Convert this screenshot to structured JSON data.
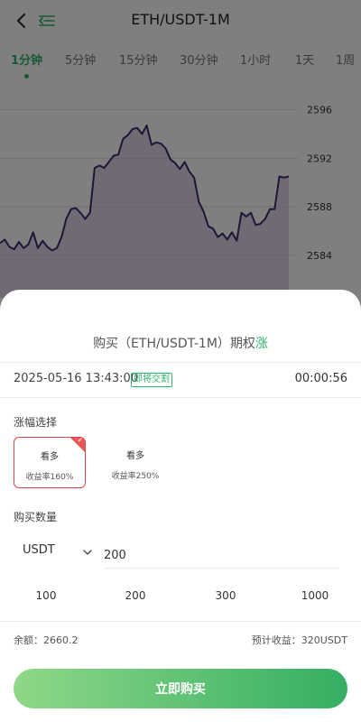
{
  "header": {
    "title": "ETH/USDT-1M"
  },
  "timeframes": [
    "1分钟",
    "5分钟",
    "15分钟",
    "30分钟",
    "1小时",
    "1天",
    "1周"
  ],
  "chart_data": {
    "type": "line",
    "y_ticks": [
      "2596",
      "2592",
      "2588",
      "2584"
    ],
    "ylim": [
      2580.5,
      2597.6
    ],
    "series": [
      {
        "values": [
          2585.0,
          2585.3,
          2584.7,
          2584.5,
          2585.1,
          2584.6,
          2584.9,
          2585.9,
          2584.6,
          2585.2,
          2584.7,
          2584.4,
          2584.6,
          2585.5,
          2587.0,
          2587.8,
          2587.9,
          2587.5,
          2587.0,
          2587.5,
          2591.2,
          2591.4,
          2591.2,
          2591.7,
          2592.2,
          2592.3,
          2593.6,
          2593.9,
          2594.4,
          2594.5,
          2594.0,
          2594.7,
          2593.1,
          2593.3,
          2593.2,
          2592.8,
          2591.9,
          2591.6,
          2591.1,
          2591.7,
          2590.9,
          2590.4,
          2588.4,
          2587.6,
          2586.4,
          2586.2,
          2585.5,
          2585.8,
          2585.3,
          2585.9,
          2585.2,
          2587.5,
          2587.2,
          2587.5,
          2586.5,
          2586.6,
          2587.0,
          2587.8,
          2587.8,
          2590.5,
          2590.4,
          2590.5
        ]
      }
    ]
  },
  "order": {
    "title_prefix": "购买（ETH/USDT-1M）期权",
    "direction": "涨",
    "datetime": "2025-05-16 13:43:00",
    "badge": "即将交割",
    "countdown": "00:00:56",
    "range_label": "涨幅选择",
    "options": [
      {
        "name": "看多",
        "rate": "收益率160%",
        "selected": true
      },
      {
        "name": "看多",
        "rate": "收益率250%",
        "selected": false
      }
    ],
    "quantity_label": "购买数量",
    "currency": "USDT",
    "amount": "200",
    "quick_amounts": [
      "100",
      "200",
      "300",
      "1000"
    ],
    "balance": "余额：2660.2",
    "expected": "预计收益：320USDT",
    "buy_label": "立即购买"
  },
  "colors": {
    "accent_green": "#2db36a",
    "selected_red": "#d94848",
    "chart_line": "#3b2d6e"
  }
}
